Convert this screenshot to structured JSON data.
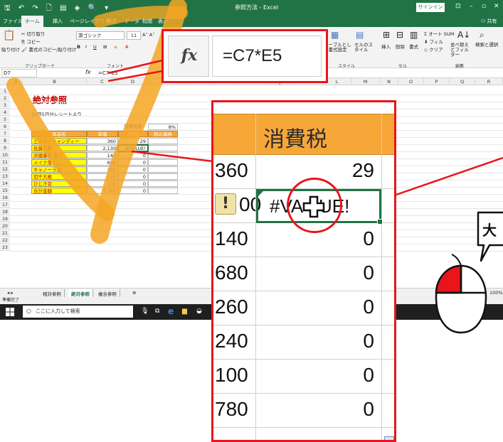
{
  "excel": {
    "quick_access": "🖫 ↶ ↷ 🗋 ▤ ◈ 🔍 ▾",
    "window_title": "参照方法 - Excel",
    "signin_label": "サインイン",
    "ribbon_tabs": [
      "ファイル",
      "ホーム",
      "挿入",
      "ページレイアウト",
      "数式",
      "データ",
      "校閲",
      "表示"
    ],
    "active_tab_index": 1,
    "share_label": "共有",
    "clipboard": {
      "paste_label": "貼り付け",
      "cut_label": "切り取り",
      "copy_label": "コピー",
      "format_painter_label": "書式のコピー/貼り付け",
      "group_label": "クリップボード"
    },
    "font": {
      "name": "游ゴシック",
      "size": "11",
      "group_label": "フォント"
    },
    "styles": {
      "table_format_label": "テーブルとして書式設定",
      "cell_style_label": "セルのスタイル",
      "group_label": "スタイル"
    },
    "cells_group": {
      "insert_label": "挿入",
      "delete_label": "削除",
      "format_label": "書式",
      "group_label": "セル"
    },
    "editing": {
      "autosum_label": "オート SUM",
      "fill_label": "フィル",
      "clear_label": "クリア",
      "sort_filter_label": "並べ替えとフィルター",
      "find_select_label": "検索と選択",
      "group_label": "編集"
    },
    "name_box": "D7",
    "formula": "=C7*E5",
    "fx_symbol": "fx",
    "column_headers": [
      "A",
      "B",
      "C",
      "D",
      "E",
      "F",
      "G",
      "H",
      "I",
      "J",
      "K",
      "L",
      "M",
      "N",
      "O",
      "P",
      "Q",
      "R"
    ],
    "row_numbers": [
      "1",
      "2",
      "3",
      "4",
      "5",
      "6",
      "7",
      "8",
      "9",
      "10",
      "11",
      "12",
      "13",
      "14",
      "15",
      "16",
      "17",
      "18",
      "19",
      "20",
      "21",
      "22",
      "23"
    ],
    "sheet_title": "絶対参照",
    "receipt_note": "10月5日分レシートより",
    "tax_rate_label": "消費税率",
    "tax_rate_value": "8%",
    "table_headers": [
      "商品名",
      "単価",
      "消費税",
      "税込価格"
    ],
    "items": [
      {
        "name": "ときめきキャンディー",
        "price": "360",
        "tax": "29"
      },
      {
        "name": "佐賀の華",
        "price": "2,130",
        "tax": "#VALUE!"
      },
      {
        "name": "浜健康茶 黒汁",
        "price": "140",
        "tax": "0"
      },
      {
        "name": "メイク落とし",
        "price": "680",
        "tax": "0"
      },
      {
        "name": "キャノーラ油",
        "price": "260",
        "tax": "0"
      },
      {
        "name": "切干大根",
        "price": "240",
        "tax": "0"
      },
      {
        "name": "ひじき豆",
        "price": "100",
        "tax": "0"
      },
      {
        "name": "合計金額",
        "price": "3,780",
        "tax": "0"
      }
    ],
    "sheet_tabs": [
      "相対参照",
      "絶対参照",
      "複合参照"
    ],
    "active_sheet_index": 1,
    "add_sheet": "⊕",
    "status_text": "準備完了",
    "zoom_label": "100%",
    "taskbar_search": "ここに入力して検索"
  },
  "formula_zoom": {
    "fx_symbol": "fx",
    "formula": "=C7*E5"
  },
  "column_zoom": {
    "header": "消費税",
    "rows": [
      {
        "left": "360",
        "right": "29"
      },
      {
        "left": "00",
        "right": "#VA✚UE!"
      },
      {
        "left": "140",
        "right": "0"
      },
      {
        "left": "680",
        "right": "0"
      },
      {
        "left": "260",
        "right": "0"
      },
      {
        "left": "240",
        "right": "0"
      },
      {
        "left": "100",
        "right": "0"
      },
      {
        "left": "780",
        "right": "0"
      }
    ],
    "error_value": "#VA✚UE!",
    "warning_symbol": "!"
  },
  "bubble_text": "大",
  "colors": {
    "excel_green": "#217346",
    "header_orange": "#f7a638",
    "highlight_red": "#e8151b",
    "item_yellow": "#ffff00",
    "watermark_orange": "#f5a623"
  }
}
